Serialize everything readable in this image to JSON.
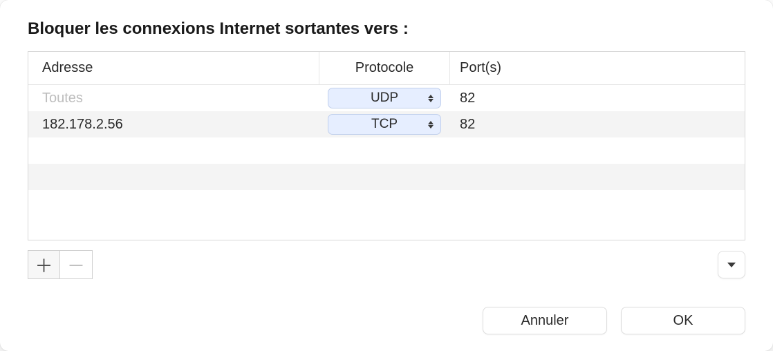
{
  "title": "Bloquer les connexions Internet sortantes vers :",
  "table": {
    "headers": {
      "address": "Adresse",
      "protocol": "Protocole",
      "ports": "Port(s)"
    },
    "rows": [
      {
        "address": "Toutes",
        "address_is_placeholder": true,
        "protocol": "UDP",
        "ports": "82"
      },
      {
        "address": "182.178.2.56",
        "address_is_placeholder": false,
        "protocol": "TCP",
        "ports": "82"
      }
    ],
    "empty_rows": 3
  },
  "toolbar": {
    "add_icon": "plus-icon",
    "remove_icon": "minus-icon",
    "dropdown_icon": "chevron-down-icon"
  },
  "footer": {
    "cancel": "Annuler",
    "ok": "OK"
  }
}
